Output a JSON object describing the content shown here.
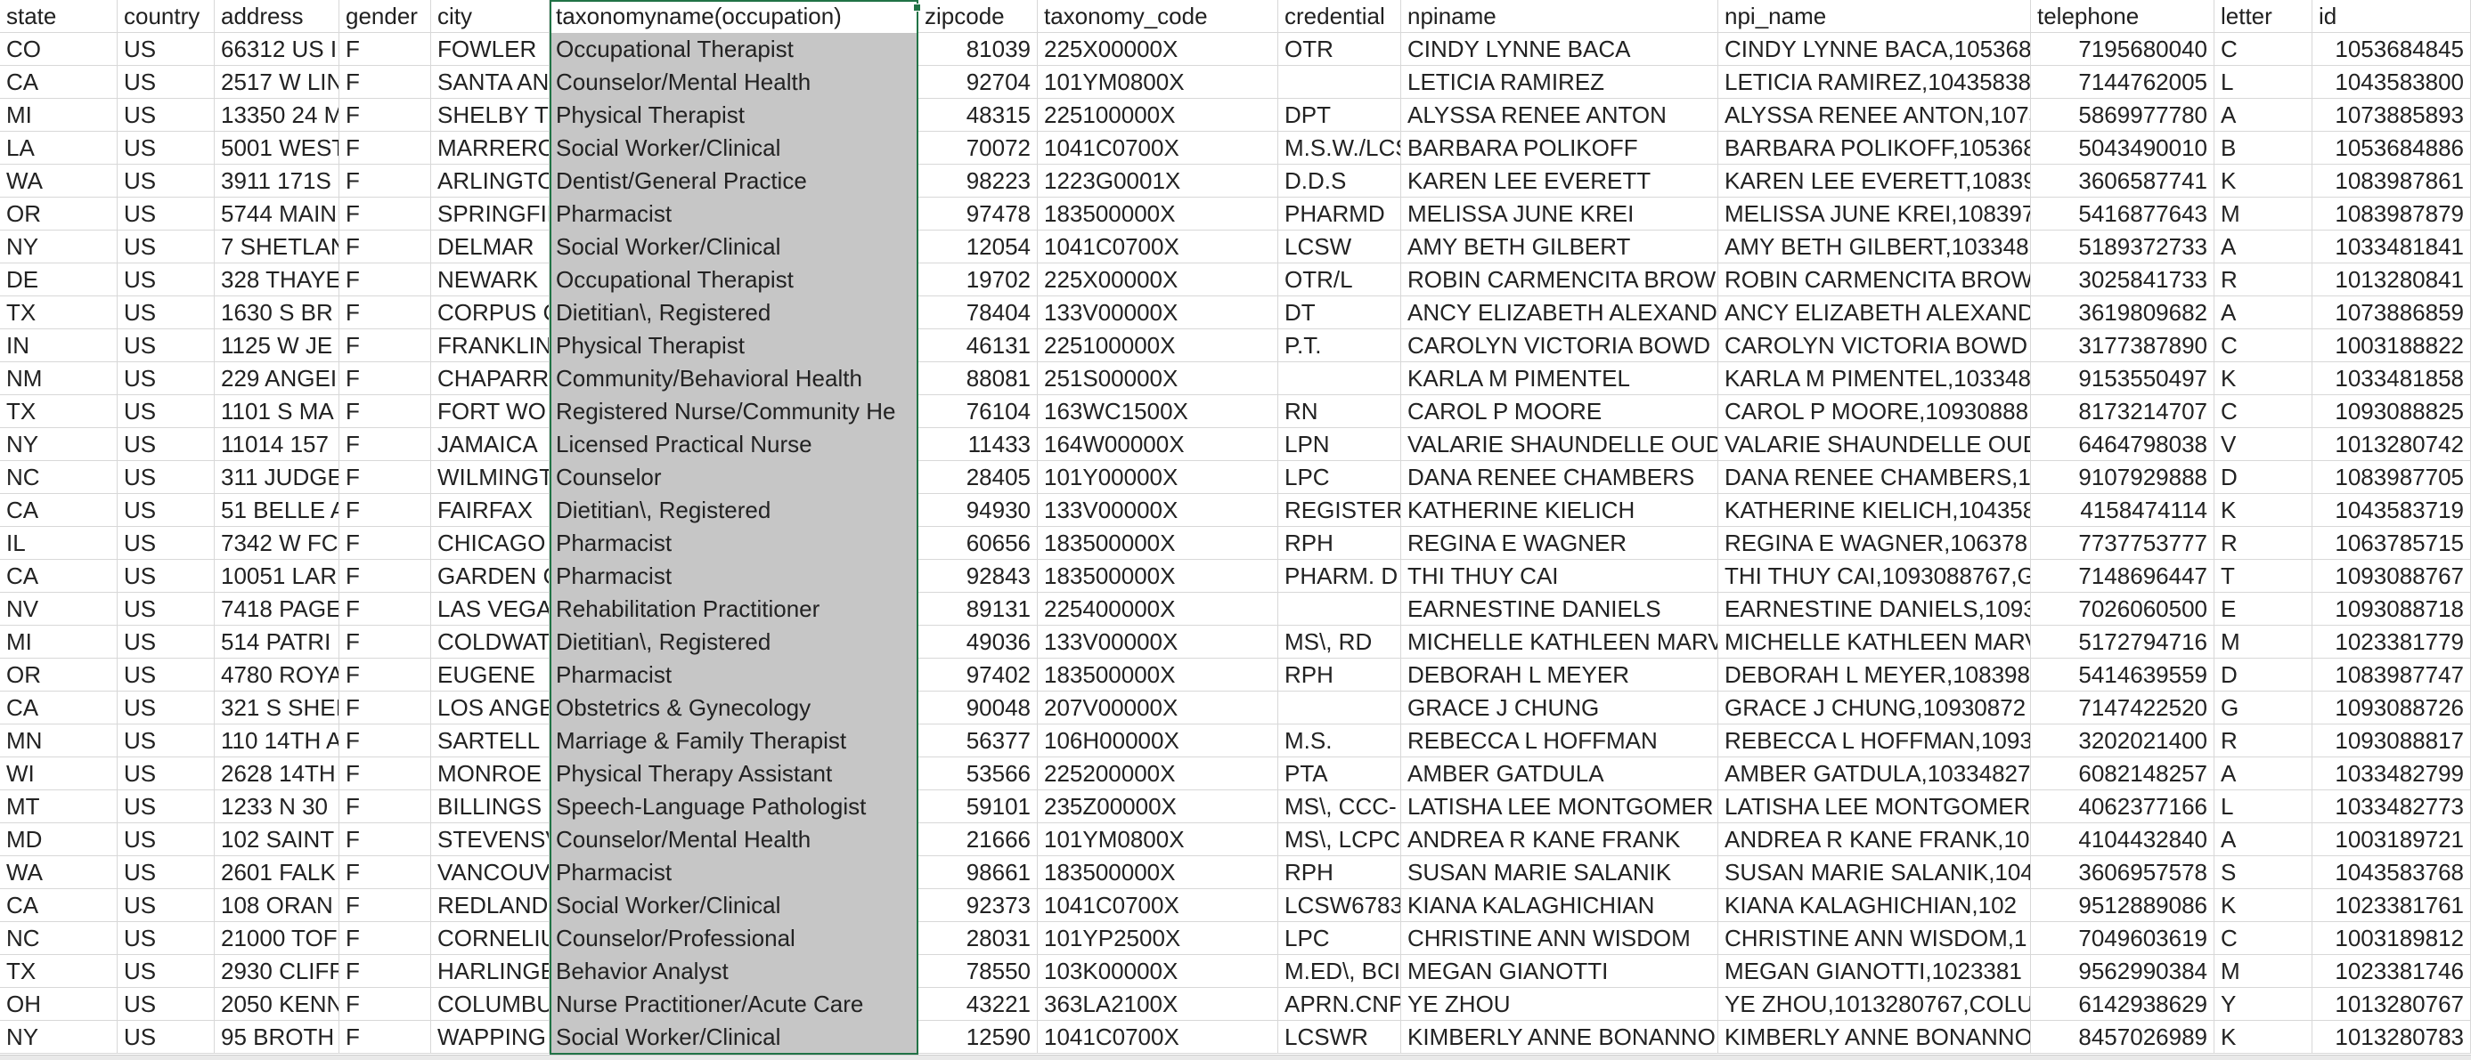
{
  "sheet": {
    "headers": [
      "state",
      "country",
      "address",
      "gender",
      "city",
      "taxonomyname(occupation)",
      "zipcode",
      "taxonomy_code",
      "credential",
      "npiname",
      "npi_name",
      "telephone",
      "letter",
      "id"
    ],
    "rows": [
      [
        "CO",
        "US",
        "66312 US I",
        "F",
        "FOWLER",
        "Occupational Therapist",
        "81039",
        "225X00000X",
        "OTR",
        "CINDY LYNNE BACA",
        "CINDY LYNNE BACA,105368",
        "7195680040",
        "C",
        "1053684845"
      ],
      [
        "CA",
        "US",
        "2517 W LIN",
        "F",
        "SANTA AN",
        "Counselor/Mental Health",
        "92704",
        "101YM0800X",
        "",
        "LETICIA  RAMIREZ",
        "LETICIA  RAMIREZ,10435838",
        "7144762005",
        "L",
        "1043583800"
      ],
      [
        "MI",
        "US",
        "13350 24 M",
        "F",
        "SHELBY TO",
        "Physical Therapist",
        "48315",
        "225100000X",
        "DPT",
        "ALYSSA RENEE ANTON",
        "ALYSSA RENEE ANTON,1073",
        "5869977780",
        "A",
        "1073885893"
      ],
      [
        "LA",
        "US",
        "5001 WEST",
        "F",
        "MARRERO",
        "Social Worker/Clinical",
        "70072",
        "1041C0700X",
        "M.S.W./LCS",
        "BARBARA  POLIKOFF",
        "BARBARA  POLIKOFF,105368",
        "5043490010",
        "B",
        "1053684886"
      ],
      [
        "WA",
        "US",
        "3911 171S",
        "F",
        "ARLINGTO",
        "Dentist/General Practice",
        "98223",
        "1223G0001X",
        "D.D.S",
        "KAREN LEE EVERETT",
        "KAREN LEE EVERETT,108398",
        "3606587741",
        "K",
        "1083987861"
      ],
      [
        "OR",
        "US",
        "5744 MAIN",
        "F",
        "SPRINGFIE",
        "Pharmacist",
        "97478",
        "183500000X",
        "PHARMD",
        "MELISSA JUNE KREI",
        "MELISSA JUNE KREI,108397",
        "5416877643",
        "M",
        "1083987879"
      ],
      [
        "NY",
        "US",
        "7 SHETLAN",
        "F",
        "DELMAR",
        "Social Worker/Clinical",
        "12054",
        "1041C0700X",
        "LCSW",
        "AMY BETH GILBERT",
        "AMY BETH GILBERT,1033481",
        "5189372733",
        "A",
        "1033481841"
      ],
      [
        "DE",
        "US",
        "328 THAYE",
        "F",
        "NEWARK",
        "Occupational Therapist",
        "19702",
        "225X00000X",
        "OTR/L",
        "ROBIN CARMENCITA BROW",
        "ROBIN CARMENCITA BROW",
        "3025841733",
        "R",
        "1013280841"
      ],
      [
        "TX",
        "US",
        "1630 S BR",
        "F",
        "CORPUS C",
        "Dietitian\\, Registered",
        "78404",
        "133V00000X",
        "DT",
        "ANCY ELIZABETH ALEXAND",
        "ANCY ELIZABETH ALEXAND",
        "3619809682",
        "A",
        "1073886859"
      ],
      [
        "IN",
        "US",
        "1125 W JE",
        "F",
        "FRANKLIN",
        "Physical Therapist",
        "46131",
        "225100000X",
        "P.T.",
        "CAROLYN VICTORIA BOWD",
        "CAROLYN VICTORIA BOWD",
        "3177387890",
        "C",
        "1003188822"
      ],
      [
        "NM",
        "US",
        "229 ANGEI",
        "F",
        "CHAPARRA",
        "Community/Behavioral Health",
        "88081",
        "251S00000X",
        "",
        "KARLA M PIMENTEL",
        "KARLA M PIMENTEL,103348",
        "9153550497",
        "K",
        "1033481858"
      ],
      [
        "TX",
        "US",
        "1101 S MA",
        "F",
        "FORT WO",
        "Registered Nurse/Community He",
        "76104",
        "163WC1500X",
        "RN",
        "CAROL P MOORE",
        "CAROL P MOORE,10930888",
        "8173214707",
        "C",
        "1093088825"
      ],
      [
        "NY",
        "US",
        "11014 157",
        "F",
        "JAMAICA",
        "Licensed Practical Nurse",
        "11433",
        "164W00000X",
        "LPN",
        "VALARIE SHAUNDELLE OUD",
        "VALARIE SHAUNDELLE OUD",
        "6464798038",
        "V",
        "1013280742"
      ],
      [
        "NC",
        "US",
        "311 JUDGE",
        "F",
        "WILMINGT",
        "Counselor",
        "28405",
        "101Y00000X",
        "LPC",
        "DANA RENEE CHAMBERS",
        "DANA RENEE CHAMBERS,1",
        "9107929888",
        "D",
        "1083987705"
      ],
      [
        "CA",
        "US",
        "51 BELLE A",
        "F",
        "FAIRFAX",
        "Dietitian\\, Registered",
        "94930",
        "133V00000X",
        "REGISTERE",
        "KATHERINE  KIELICH",
        "KATHERINE  KIELICH,104358",
        "4158474114",
        "K",
        "1043583719"
      ],
      [
        "IL",
        "US",
        "7342 W FC",
        "F",
        "CHICAGO",
        "Pharmacist",
        "60656",
        "183500000X",
        "RPH",
        "REGINA E WAGNER",
        "REGINA E WAGNER,106378",
        "7737753777",
        "R",
        "1063785715"
      ],
      [
        "CA",
        "US",
        "10051 LAR",
        "F",
        "GARDEN C",
        "Pharmacist",
        "92843",
        "183500000X",
        "PHARM. D",
        "THI THUY CAI",
        "THI THUY CAI,1093088767,G",
        "7148696447",
        "T",
        "1093088767"
      ],
      [
        "NV",
        "US",
        "7418 PAGE",
        "F",
        "LAS VEGAS",
        "Rehabilitation Practitioner",
        "89131",
        "225400000X",
        "",
        "EARNESTINE  DANIELS",
        "EARNESTINE  DANIELS,1093",
        "7026060500",
        "E",
        "1093088718"
      ],
      [
        "MI",
        "US",
        "514 PATRI",
        "F",
        "COLDWAT",
        "Dietitian\\, Registered",
        "49036",
        "133V00000X",
        "MS\\, RD",
        "MICHELLE KATHLEEN MARV",
        "MICHELLE KATHLEEN MARV",
        "5172794716",
        "M",
        "1023381779"
      ],
      [
        "OR",
        "US",
        "4780 ROYA",
        "F",
        "EUGENE",
        "Pharmacist",
        "97402",
        "183500000X",
        "RPH",
        "DEBORAH L MEYER",
        "DEBORAH L MEYER,108398",
        "5414639559",
        "D",
        "1083987747"
      ],
      [
        "CA",
        "US",
        "321 S SHEI",
        "F",
        "LOS ANGE",
        "Obstetrics & Gynecology",
        "90048",
        "207V00000X",
        "",
        "GRACE J CHUNG",
        "GRACE J CHUNG,10930872",
        "7147422520",
        "G",
        "1093088726"
      ],
      [
        "MN",
        "US",
        "110 14TH A",
        "F",
        "SARTELL",
        "Marriage & Family Therapist",
        "56377",
        "106H00000X",
        "M.S.",
        "REBECCA L HOFFMAN",
        "REBECCA L HOFFMAN,1093",
        "3202021400",
        "R",
        "1093088817"
      ],
      [
        "WI",
        "US",
        "2628 14TH",
        "F",
        "MONROE",
        "Physical Therapy Assistant",
        "53566",
        "225200000X",
        "PTA",
        "AMBER  GATDULA",
        "AMBER  GATDULA,10334827",
        "6082148257",
        "A",
        "1033482799"
      ],
      [
        "MT",
        "US",
        "1233 N 30",
        "F",
        "BILLINGS",
        "Speech-Language Pathologist",
        "59101",
        "235Z00000X",
        "MS\\, CCC-",
        "LATISHA LEE MONTGOMER",
        "LATISHA LEE MONTGOMER",
        "4062377166",
        "L",
        "1033482773"
      ],
      [
        "MD",
        "US",
        "102 SAINT",
        "F",
        "STEVENSV",
        "Counselor/Mental Health",
        "21666",
        "101YM0800X",
        "MS\\, LCPC",
        "ANDREA R KANE FRANK",
        "ANDREA R KANE FRANK,10",
        "4104432840",
        "A",
        "1003189721"
      ],
      [
        "WA",
        "US",
        "2601 FALK",
        "F",
        "VANCOUV",
        "Pharmacist",
        "98661",
        "183500000X",
        "RPH",
        "SUSAN MARIE SALANIK",
        "SUSAN MARIE SALANIK,104",
        "3606957578",
        "S",
        "1043583768"
      ],
      [
        "CA",
        "US",
        "108 ORAN",
        "F",
        "REDLANDS",
        "Social Worker/Clinical",
        "92373",
        "1041C0700X",
        "LCSW6783",
        "KIANA  KALAGHICHIAN",
        "KIANA  KALAGHICHIAN,102",
        "9512889086",
        "K",
        "1023381761"
      ],
      [
        "NC",
        "US",
        "21000 TOF",
        "F",
        "CORNELIU",
        "Counselor/Professional",
        "28031",
        "101YP2500X",
        "LPC",
        "CHRISTINE ANN WISDOM",
        "CHRISTINE ANN WISDOM,1",
        "7049603619",
        "C",
        "1003189812"
      ],
      [
        "TX",
        "US",
        "2930 CLIFF",
        "F",
        "HARLINGE",
        "Behavior Analyst",
        "78550",
        "103K00000X",
        "M.ED\\, BCI",
        "MEGAN  GIANOTTI",
        "MEGAN  GIANOTTI,1023381",
        "9562990384",
        "M",
        "1023381746"
      ],
      [
        "OH",
        "US",
        "2050 KENN",
        "F",
        "COLUMBU",
        "Nurse Practitioner/Acute Care",
        "43221",
        "363LA2100X",
        "APRN.CNP",
        "YE  ZHOU",
        "YE  ZHOU,1013280767,COLU",
        "6142938629",
        "Y",
        "1013280767"
      ],
      [
        "NY",
        "US",
        "95 BROTH",
        "F",
        "WAPPING",
        "Social Worker/Clinical",
        "12590",
        "1041C0700X",
        "LCSWR",
        "KIMBERLY ANNE BONANNO",
        "KIMBERLY ANNE BONANNO",
        "8457026989",
        "K",
        "1013280783"
      ]
    ]
  }
}
